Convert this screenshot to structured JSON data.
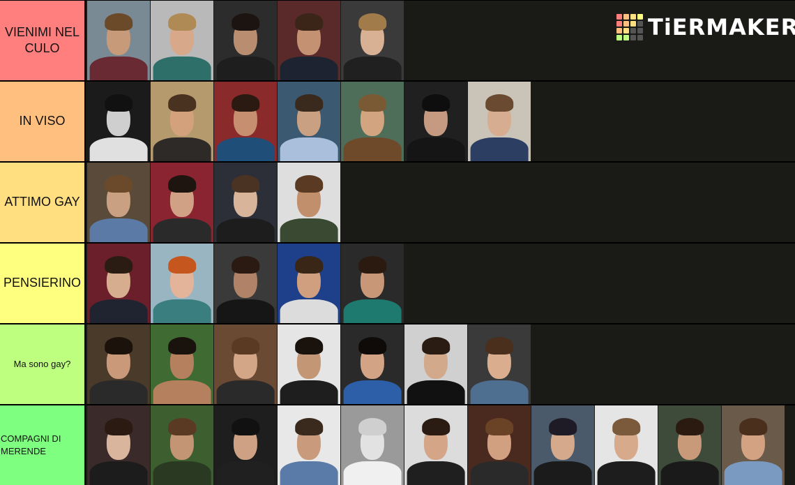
{
  "brand": {
    "name": "TiERMAKER",
    "logo_colors": [
      "#ff7f7f",
      "#ffbf7f",
      "#ffdf7f",
      "#ffff7f",
      "#ff7f7f",
      "#ffbf7f",
      "#ffdf7f",
      "#555555",
      "#ffbf7f",
      "#ffdf7f",
      "#555555",
      "#555555",
      "#bfff7f",
      "#bfff7f",
      "#555555",
      "#555555"
    ]
  },
  "tiers": [
    {
      "label": "VIENIMI NEL CULO",
      "color": "#ff7f7f",
      "items": [
        {
          "bg": "#7a8a95",
          "skin": "#c79a7a",
          "hair": "#6b4a2a",
          "cloth": "#6a2a33"
        },
        {
          "bg": "#b9b9b9",
          "skin": "#d7a98a",
          "hair": "#b08a55",
          "cloth": "#2f6f6a"
        },
        {
          "bg": "#2c2c2c",
          "skin": "#b98d70",
          "hair": "#1c1410",
          "cloth": "#1e1e1e"
        },
        {
          "bg": "#5a2a2a",
          "skin": "#c49272",
          "hair": "#3a2518",
          "cloth": "#1d2330"
        },
        {
          "bg": "#3a3a3a",
          "skin": "#d8b195",
          "hair": "#a27b4a",
          "cloth": "#202020"
        }
      ]
    },
    {
      "label": "IN VISO",
      "color": "#ffbf7f",
      "items": [
        {
          "bg": "#1b1b1b",
          "skin": "#cfcfcf",
          "hair": "#111111",
          "cloth": "#e0e0e0"
        },
        {
          "bg": "#b59a6e",
          "skin": "#d3a27c",
          "hair": "#4a3220",
          "cloth": "#2d2a27"
        },
        {
          "bg": "#8a2a2a",
          "skin": "#c58f70",
          "hair": "#2a1a12",
          "cloth": "#1f4e78"
        },
        {
          "bg": "#3b5a72",
          "skin": "#caa083",
          "hair": "#3a2a1e",
          "cloth": "#a9bfdc"
        },
        {
          "bg": "#4f6e5a",
          "skin": "#d2a47f",
          "hair": "#7a5a35",
          "cloth": "#6e4a2a"
        },
        {
          "bg": "#202020",
          "skin": "#c69a80",
          "hair": "#0e0e0e",
          "cloth": "#151515"
        },
        {
          "bg": "#c9c3b8",
          "skin": "#d6ad90",
          "hair": "#6a4a30",
          "cloth": "#2c3f63"
        }
      ]
    },
    {
      "label": "ATTIMO GAY",
      "color": "#ffdf7f",
      "items": [
        {
          "bg": "#5a4a3a",
          "skin": "#caa083",
          "hair": "#6a4a2a",
          "cloth": "#5b7aa6"
        },
        {
          "bg": "#8a2430",
          "skin": "#d1a185",
          "hair": "#1e1510",
          "cloth": "#2a2a2a"
        },
        {
          "bg": "#2c2f38",
          "skin": "#d8b49a",
          "hair": "#4a3322",
          "cloth": "#1d1d1d"
        },
        {
          "bg": "#dedede",
          "skin": "#c28f6c",
          "hair": "#5a3a22",
          "cloth": "#3a4a32"
        }
      ]
    },
    {
      "label": "PENSIERINO",
      "color": "#ffff7f",
      "items": [
        {
          "bg": "#6a1f2a",
          "skin": "#d7ad90",
          "hair": "#2a1c12",
          "cloth": "#1f2430"
        },
        {
          "bg": "#9ab5c2",
          "skin": "#e3b39a",
          "hair": "#c4561e",
          "cloth": "#3a7e7f"
        },
        {
          "bg": "#3a3a3a",
          "skin": "#b08368",
          "hair": "#2a1a12",
          "cloth": "#161616"
        },
        {
          "bg": "#1e3f8a",
          "skin": "#cf9f80",
          "hair": "#3a2616",
          "cloth": "#dcdcdc"
        },
        {
          "bg": "#2a2a2a",
          "skin": "#c89778",
          "hair": "#2a1a10",
          "cloth": "#1e7a6e"
        }
      ]
    },
    {
      "label": "Ma sono gay?",
      "color": "#bfff7f",
      "small": true,
      "items": [
        {
          "bg": "#4a3a2a",
          "skin": "#c9997a",
          "hair": "#1b120c",
          "cloth": "#2a2a2a"
        },
        {
          "bg": "#3f6a32",
          "skin": "#b5805e",
          "hair": "#1a120c",
          "cloth": "#b5805e"
        },
        {
          "bg": "#6a4a32",
          "skin": "#d4a688",
          "hair": "#5a3a22",
          "cloth": "#2a2a2a"
        },
        {
          "bg": "#e5e5e5",
          "skin": "#c39676",
          "hair": "#1a120c",
          "cloth": "#1e1e1e"
        },
        {
          "bg": "#2a2a2a",
          "skin": "#d2a385",
          "hair": "#0f0b08",
          "cloth": "#2c5fa8"
        },
        {
          "bg": "#d0d0d0",
          "skin": "#d3a98c",
          "hair": "#2a1c12",
          "cloth": "#111111"
        },
        {
          "bg": "#3a3a3a",
          "skin": "#d9ad8e",
          "hair": "#4a2f1c",
          "cloth": "#4f6f90"
        }
      ]
    },
    {
      "label": "COMPAGNI DI MERENDE",
      "color": "#7fff7f",
      "left": true,
      "items": [
        {
          "bg": "#3a2a2a",
          "skin": "#d9b59e",
          "hair": "#2a1a12",
          "cloth": "#1c1c1c"
        },
        {
          "bg": "#3d5e2e",
          "skin": "#c49575",
          "hair": "#5a3a22",
          "cloth": "#2a3a22"
        },
        {
          "bg": "#1e1e1e",
          "skin": "#cfa184",
          "hair": "#111111",
          "cloth": "#202020"
        },
        {
          "bg": "#e8e8e8",
          "skin": "#c99a7c",
          "hair": "#3a2a1e",
          "cloth": "#5a7aa8"
        },
        {
          "bg": "#9a9a9a",
          "skin": "#e2e2e2",
          "hair": "#cfcfcf",
          "cloth": "#f0f0f0"
        },
        {
          "bg": "#dcdcdc",
          "skin": "#d4a587",
          "hair": "#2a1c12",
          "cloth": "#1f1f1f"
        },
        {
          "bg": "#4a2a1e",
          "skin": "#d0a080",
          "hair": "#6a4226",
          "cloth": "#2a2a2a"
        },
        {
          "bg": "#4a5a6a",
          "skin": "#d4a98c",
          "hair": "#1e1a26",
          "cloth": "#1b1b1b"
        },
        {
          "bg": "#e5e5e5",
          "skin": "#d6aa8a",
          "hair": "#7a5a3a",
          "cloth": "#1d1d1d"
        },
        {
          "bg": "#3e4a3a",
          "skin": "#c89a7a",
          "hair": "#2a1a10",
          "cloth": "#1a1a1a"
        },
        {
          "bg": "#6a5a4a",
          "skin": "#d2a282",
          "hair": "#4a2f1c",
          "cloth": "#7a9ac2"
        }
      ]
    }
  ]
}
